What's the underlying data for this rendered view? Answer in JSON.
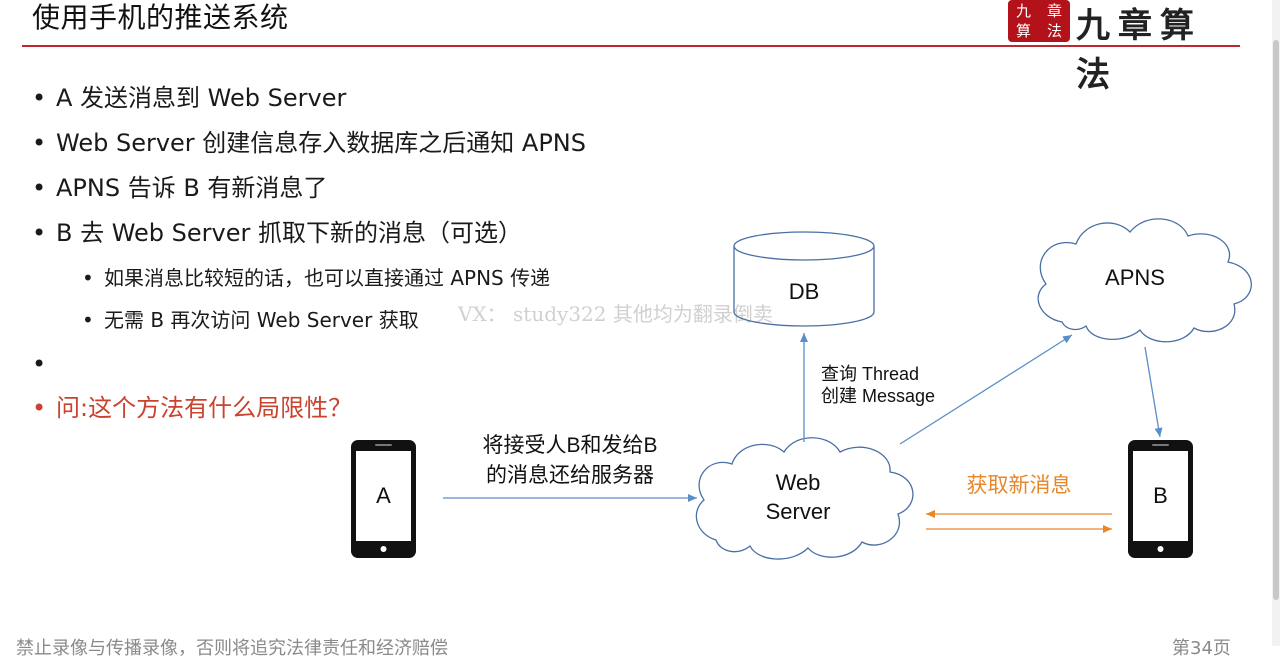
{
  "title": "使用手机的推送系统",
  "logo": {
    "seal_chars": [
      "九",
      "章",
      "算",
      "法"
    ],
    "text": "九章算法"
  },
  "bullets": [
    {
      "text": "A 发送消息到 Web Server",
      "level": 1
    },
    {
      "text": "Web Server 创建信息存入数据库之后通知 APNS",
      "level": 1
    },
    {
      "text": "APNS 告诉 B 有新消息了",
      "level": 1
    },
    {
      "text": "B 去 Web Server 抓取下新的消息（可选）",
      "level": 1
    },
    {
      "text": "如果消息比较短的话，也可以直接通过 APNS 传递",
      "level": 2
    },
    {
      "text": "无需 B 再次访问 Web Server 获取",
      "level": 2
    },
    {
      "text": "",
      "level": 1
    },
    {
      "text": "问:这个方法有什么局限性？",
      "level": 1,
      "highlight": true
    }
  ],
  "diagram": {
    "phone_a": "A",
    "phone_b": "B",
    "db": "DB",
    "apns": "APNS",
    "web_server_line1": "Web",
    "web_server_line2": "Server",
    "db_label_line1": "查询 Thread",
    "db_label_line2": "创建 Message",
    "a_to_server_line1": "将接受人B和发给B",
    "a_to_server_line2": "的消息还给服务器",
    "fetch_label": "获取新消息"
  },
  "watermark": "VX： study322 其他均为翻录倒卖",
  "footer": {
    "left": "禁止录像与传播录像，否则将追究法律责任和经济赔偿",
    "right": "第34页"
  },
  "colors": {
    "accent_red": "#c0262d",
    "highlight_text": "#c9432e",
    "arrow_blue": "#5a8ec8",
    "arrow_orange": "#e8862a"
  }
}
